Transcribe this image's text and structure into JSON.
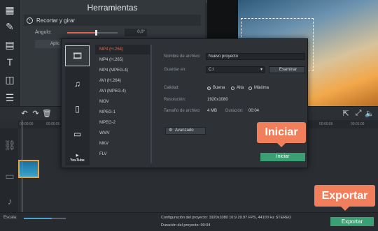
{
  "tools_panel": {
    "title": "Herramientas",
    "section": "Recortar y girar",
    "angle_label": "Ángulo:",
    "angle_value": "0,0°",
    "apply_label": "Aplic",
    "angle_level": 0.58
  },
  "export_dialog": {
    "formats": [
      "MP4 (H.264)",
      "MP4 (H.265)",
      "MP4 (MPEG-4)",
      "AVI (H.264)",
      "AVI (MPEG-4)",
      "MOV",
      "MPEG-1",
      "MPEG-2",
      "WMV",
      "MKV",
      "FLV"
    ],
    "selected_format": "MP4 (H.264)",
    "youtube_label": "YouTube",
    "file_name_label": "Nombre de archivo:",
    "file_name_value": "Nuevo proyecto",
    "save_in_label": "Guardar en:",
    "save_in_value": "C:\\",
    "browse_label": "Examinar",
    "quality_label": "Calidad:",
    "quality_options": [
      "Buena",
      "Alta",
      "Máxima"
    ],
    "quality_selected": "Buena",
    "resolution_label": "Resolución:",
    "resolution_value": "1920x1080",
    "file_size_label": "Tamaño de archivo:",
    "file_size_value": "4 MB",
    "duration_label": "Duración:",
    "duration_value": "00:04",
    "advanced_label": "Avanzado",
    "start_label": "Iniciar"
  },
  "callouts": {
    "start": "Iniciar",
    "export": "Exportar"
  },
  "timeline": {
    "time_start": "00:00:00",
    "time_mid": "00:00:05",
    "time_a": "00:00:55",
    "time_b": "00:01:00"
  },
  "footer": {
    "scale_label": "Escala:",
    "scale_level": 0.66,
    "config_text": "Configuración del proyecto:  1920x1080 16:9 29.97 FPS, 44100 Hz STEREO",
    "duration_text": "Duración del proyecto:        00:04",
    "export_label": "Exportar"
  },
  "colors": {
    "accent": "#e4674f",
    "export_green": "#3a9f72",
    "callout": "#f27f5b"
  }
}
